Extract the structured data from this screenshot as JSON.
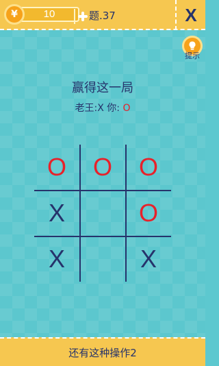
{
  "header": {
    "coin_count": "10",
    "coin_symbol": "¥",
    "level_label": "题.37",
    "close_label": "X"
  },
  "hint": {
    "label": "提示"
  },
  "puzzle": {
    "title": "赢得这一局",
    "players_prefix": "老王:X 你: ",
    "you_mark": "O"
  },
  "board": {
    "cells": [
      [
        "O",
        "O",
        "O"
      ],
      [
        "X",
        "",
        "O"
      ],
      [
        "X",
        "",
        "X"
      ]
    ]
  },
  "footer": {
    "text": "还有这种操作2"
  },
  "colors": {
    "background": "#5cc7ce",
    "bar": "#f6c750",
    "ink": "#26336b",
    "o_mark": "#e8212a",
    "coin": "#f7a21a"
  }
}
